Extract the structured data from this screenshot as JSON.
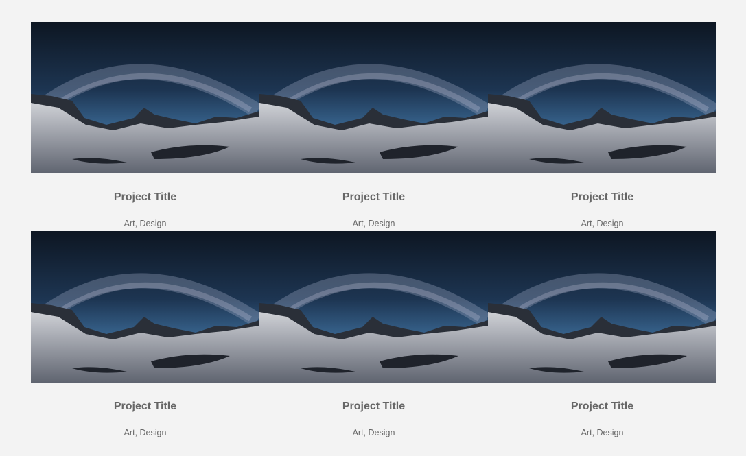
{
  "portfolio": {
    "items": [
      {
        "title": "Project Title",
        "categories": "Art, Design",
        "image": "night-sky-mountain-lake-photo"
      },
      {
        "title": "Project Title",
        "categories": "Art, Design",
        "image": "night-sky-mountain-lake-photo"
      },
      {
        "title": "Project Title",
        "categories": "Art, Design",
        "image": "night-sky-mountain-lake-photo"
      },
      {
        "title": "Project Title",
        "categories": "Art, Design",
        "image": "night-sky-mountain-lake-photo"
      },
      {
        "title": "Project Title",
        "categories": "Art, Design",
        "image": "night-sky-mountain-lake-photo"
      },
      {
        "title": "Project Title",
        "categories": "Art, Design",
        "image": "night-sky-mountain-lake-photo"
      }
    ]
  },
  "colors": {
    "page_background": "#f3f3f3",
    "text": "#666666",
    "sky_top": "#0f1a28",
    "sky_horizon": "#3a6ea0",
    "snow": "#b9bcc2"
  }
}
